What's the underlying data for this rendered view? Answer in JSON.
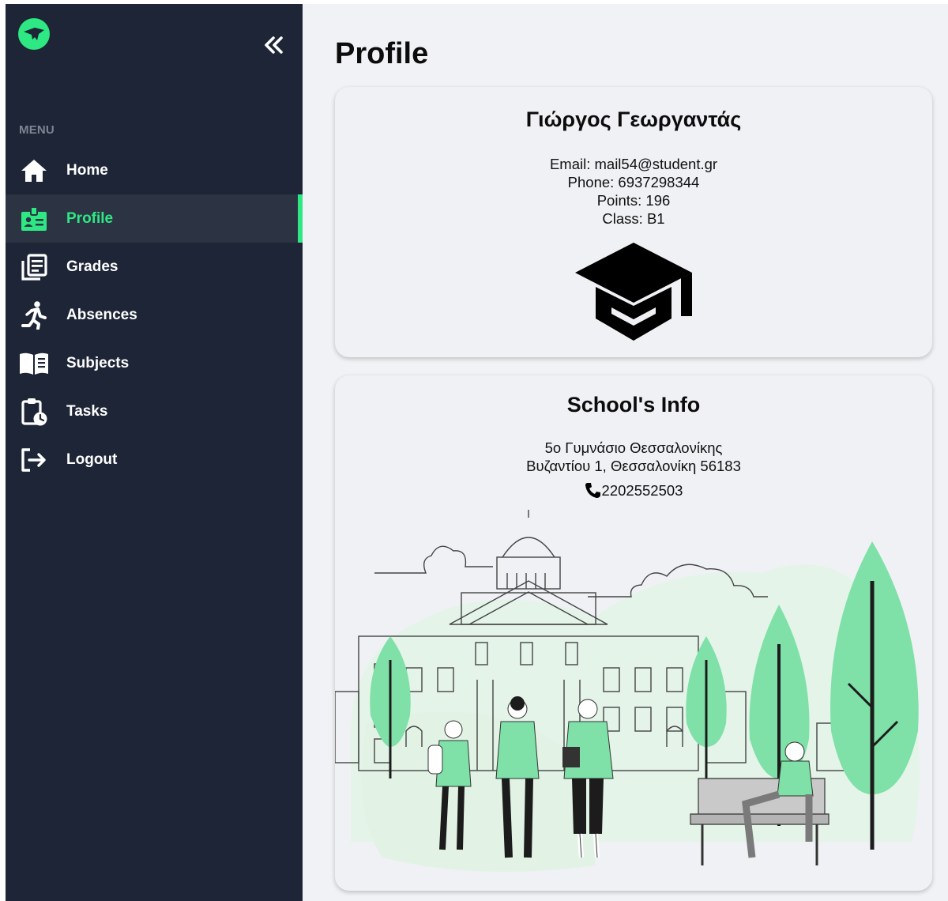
{
  "sidebar": {
    "menu_label": "MENU",
    "items": [
      {
        "label": "Home",
        "icon": "home-icon",
        "active": false
      },
      {
        "label": "Profile",
        "icon": "id-badge-icon",
        "active": true
      },
      {
        "label": "Grades",
        "icon": "grades-icon",
        "active": false
      },
      {
        "label": "Absences",
        "icon": "running-person-icon",
        "active": false
      },
      {
        "label": "Subjects",
        "icon": "open-book-icon",
        "active": false
      },
      {
        "label": "Tasks",
        "icon": "clipboard-clock-icon",
        "active": false
      },
      {
        "label": "Logout",
        "icon": "logout-icon",
        "active": false
      }
    ]
  },
  "page": {
    "title": "Profile"
  },
  "profile": {
    "name": "Γιώργος Γεωργαντάς",
    "email_line": "Email: mail54@student.gr",
    "phone_line": "Phone: 6937298344",
    "points_line": "Points: 196",
    "class_line": "Class: B1"
  },
  "school": {
    "title": "School's Info",
    "name": "5ο Γυμνάσιο Θεσσαλονίκης",
    "address": "Βυζαντίου 1, Θεσσαλονίκη 56183",
    "phone": "2202552503"
  },
  "colors": {
    "sidebar_bg": "#1d2536",
    "active_item_bg": "#2c3444",
    "accent": "#2ee883",
    "page_bg": "#f0f2f5",
    "illustration_green": "#7fe0a8"
  }
}
